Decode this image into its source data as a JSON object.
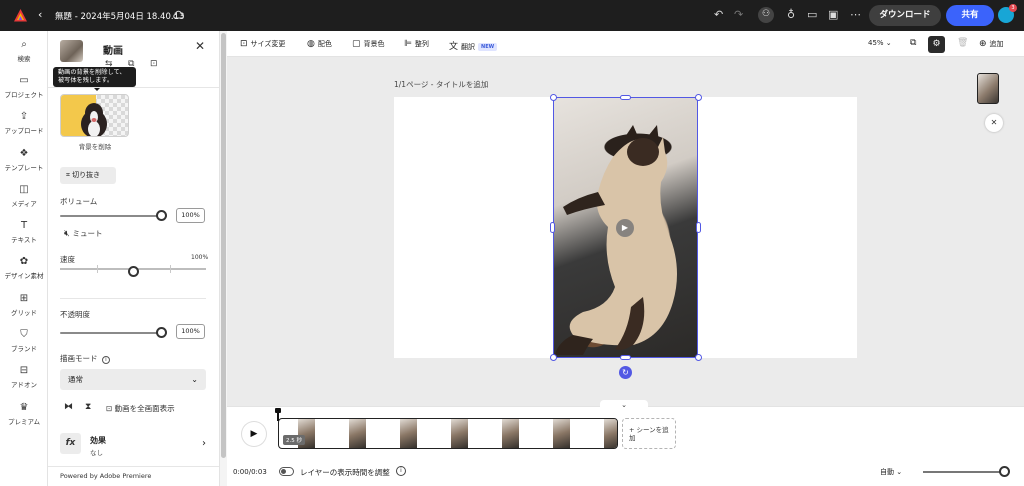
{
  "app": {
    "doc_title": "無題 - 2024年5月04日 18.40.13",
    "download_label": "ダウンロード",
    "share_label": "共有",
    "avatar_badge": "3",
    "icons": [
      "adobe-express-logo-icon",
      "chevron-left-icon",
      "cloud-icon",
      "undo-icon",
      "redo-icon",
      "add-person-icon",
      "lightbulb-icon",
      "comment-icon",
      "present-icon",
      "more-icon"
    ]
  },
  "rail": {
    "items": [
      {
        "label": "検索",
        "icon": "search-icon"
      },
      {
        "label": "プロジェクト",
        "icon": "folder-icon"
      },
      {
        "label": "アップロード",
        "icon": "upload-cloud-icon"
      },
      {
        "label": "テンプレート",
        "icon": "template-icon"
      },
      {
        "label": "メディア",
        "icon": "media-icon"
      },
      {
        "label": "テキスト",
        "icon": "text-icon"
      },
      {
        "label": "デザイン素材",
        "icon": "shapes-icon"
      },
      {
        "label": "グリッド",
        "icon": "grid-icon"
      },
      {
        "label": "ブランド",
        "icon": "brand-icon"
      },
      {
        "label": "アドオン",
        "icon": "addons-icon"
      },
      {
        "label": "プレミアム",
        "icon": "crown-icon"
      }
    ]
  },
  "panel": {
    "title": "動画",
    "tooltip": "動画の背景を削除して、被写体を残します。",
    "remove_bg_label": "背景を削除",
    "crop_label": "切り抜き",
    "volume_label": "ボリューム",
    "volume_value": "100%",
    "volume_level": 1.0,
    "mute_label": "ミュート",
    "speed_label": "速度",
    "speed_value": "100%",
    "speed_level": 0.5,
    "opacity_label": "不透明度",
    "opacity_value": "100%",
    "opacity_level": 1.0,
    "blend_label": "描画モード",
    "blend_value": "通常",
    "fullscreen_label": "動画を全画面表示",
    "effects_label": "効果",
    "effects_value": "なし",
    "powered_by": "Powered by Adobe Premiere"
  },
  "canvas_toolbar": {
    "resize": "サイズ変更",
    "colors": "配色",
    "background": "背景色",
    "arrange": "整列",
    "translate": "翻訳",
    "new_badge": "NEW",
    "zoom": "45%",
    "add": "追加"
  },
  "stage": {
    "page_label": "1/1ページ - タイトルを追加"
  },
  "timeline": {
    "duration_badge": "2.5 秒",
    "add_scene": "+ シーンを追加",
    "time": "0:00/0:03",
    "toggle_label": "レイヤーの表示時間を調整",
    "playback_mode": "自動",
    "zoom_level": 1.0
  }
}
